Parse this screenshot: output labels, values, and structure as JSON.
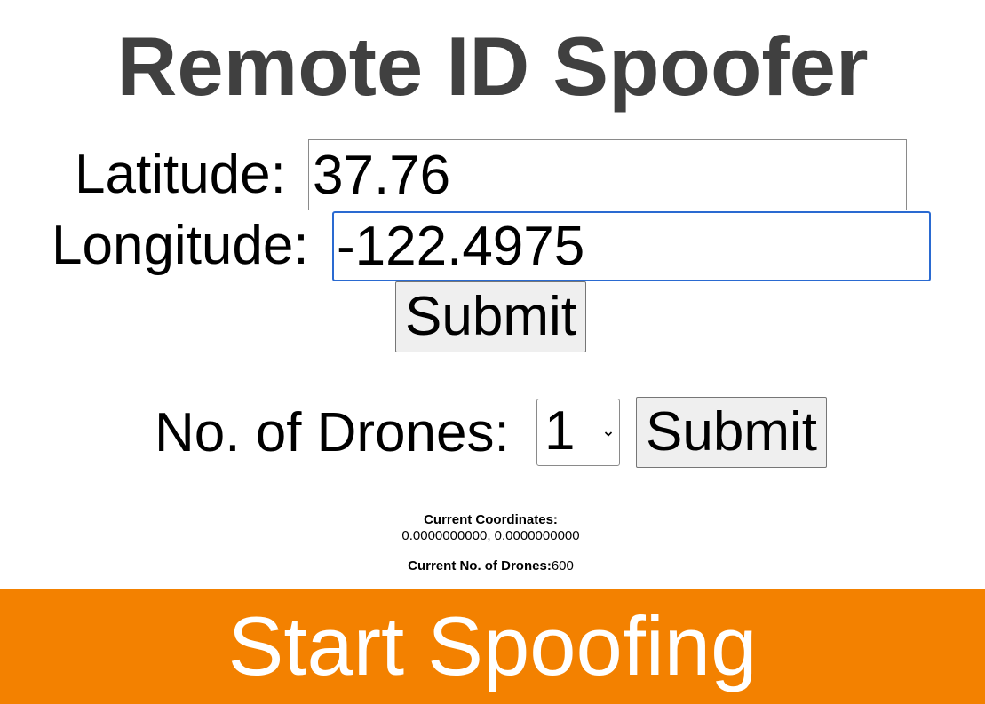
{
  "title": "Remote ID Spoofer",
  "form": {
    "latitude_label": "Latitude:",
    "latitude_value": "37.76",
    "longitude_label": "Longitude:",
    "longitude_value": "-122.4975",
    "submit_label": "Submit"
  },
  "drones": {
    "label": "No. of Drones:",
    "selected": "1",
    "submit_label": "Submit"
  },
  "status": {
    "coordinates_label": "Current Coordinates:",
    "coordinates_value": "0.0000000000, 0.0000000000",
    "drones_label": "Current No. of Drones:",
    "drones_value": "600"
  },
  "start_button": "Start Spoofing",
  "colors": {
    "title": "#404040",
    "accent": "#f38100",
    "focus_border": "#2a6ad1"
  }
}
